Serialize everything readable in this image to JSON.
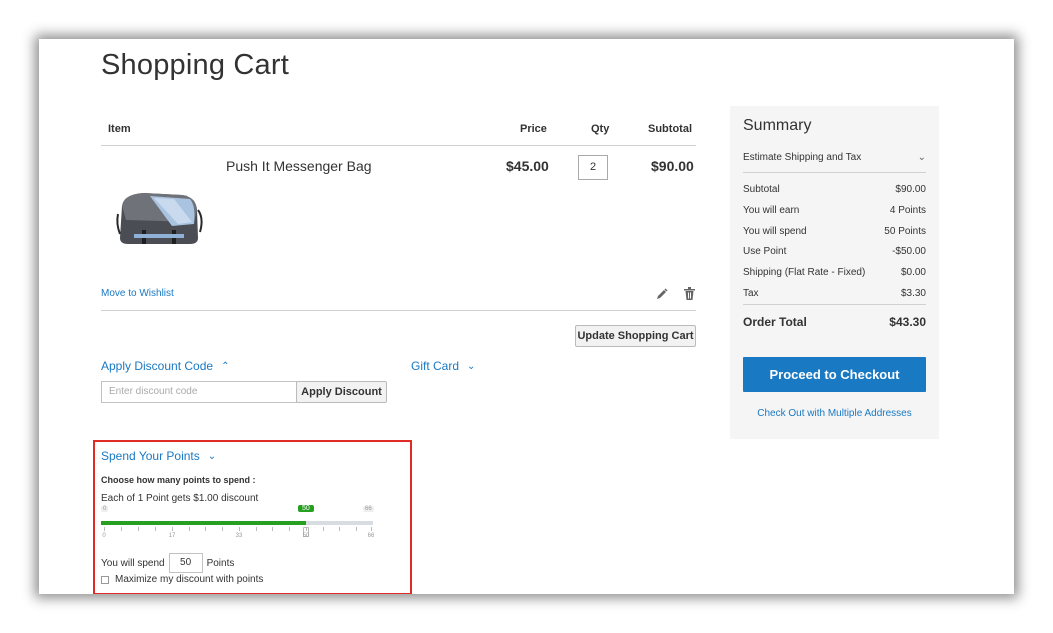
{
  "page": {
    "title": "Shopping Cart"
  },
  "cart": {
    "headers": {
      "item": "Item",
      "price": "Price",
      "qty": "Qty",
      "subtotal": "Subtotal"
    },
    "item": {
      "name": "Push It Messenger Bag",
      "price": "$45.00",
      "qty": "2",
      "subtotal": "$90.00"
    },
    "move_to_wishlist": "Move to Wishlist",
    "update_button": "Update Shopping Cart"
  },
  "discount": {
    "title": "Apply Discount Code",
    "placeholder": "Enter discount code",
    "button": "Apply Discount"
  },
  "gift_card": {
    "title": "Gift Card"
  },
  "points": {
    "title": "Spend Your Points",
    "choose_label": "Choose how many points to spend :",
    "rate_text": "Each of 1 Point gets $1.00 discount",
    "slider": {
      "min": "0",
      "max": "66",
      "value": "50",
      "ticks": [
        "0",
        "17",
        "33",
        "50",
        "66"
      ]
    },
    "spend_prefix": "You will spend",
    "spend_value": "50",
    "spend_suffix": "Points",
    "maximize_label": "Maximize my discount with points"
  },
  "summary": {
    "title": "Summary",
    "estimate_label": "Estimate Shipping and Tax",
    "rows": [
      {
        "label": "Subtotal",
        "value": "$90.00"
      },
      {
        "label": "You will earn",
        "value": "4 Points"
      },
      {
        "label": "You will spend",
        "value": "50 Points"
      },
      {
        "label": "Use Point",
        "value": "-$50.00"
      },
      {
        "label": "Shipping (Flat Rate - Fixed)",
        "value": "$0.00"
      },
      {
        "label": "Tax",
        "value": "$3.30"
      }
    ],
    "order_total_label": "Order Total",
    "order_total_value": "$43.30",
    "checkout_button": "Proceed to Checkout",
    "multi_address_link": "Check Out with Multiple Addresses"
  },
  "colors": {
    "accent": "#1979c3",
    "slider_green": "#27a022",
    "highlight_red": "#e02b27"
  }
}
